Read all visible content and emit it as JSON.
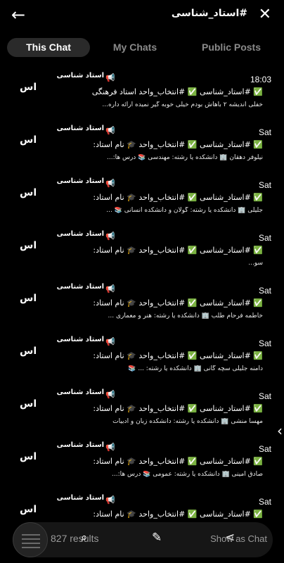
{
  "header": {
    "back_icon": "arrow-left-icon",
    "query": "#استاد_شناسی",
    "close_icon": "close-icon"
  },
  "tabs": [
    {
      "label": "This Chat",
      "active": true
    },
    {
      "label": "My Chats",
      "active": false
    },
    {
      "label": "Public Posts",
      "active": false
    }
  ],
  "results": [
    {
      "avatar": "اس",
      "author": "استاد شناسی",
      "time": "18:03",
      "line1": "✅ #استاد_شناسی ✅ #انتخاب_واحد استاد فرهنگی",
      "line2": "خفلی اندیشه ۲ باهاش بودم خیلی خوبه گیر نمیده ارائه داره..."
    },
    {
      "avatar": "اس",
      "author": "استاد شناسی",
      "time": "Sat",
      "line1": "✅ #استاد_شناسی ✅ #انتخاب_واحد 🎓 نام استاد:",
      "line2": "نیلوفر دهقان 🏢 دانشکده یا رشته: مهندسی 📚 درس ها:..."
    },
    {
      "avatar": "اس",
      "author": "استاد شناسی",
      "time": "Sat",
      "line1": "✅ #استاد_شناسی ✅ #انتخاب_واحد 🎓 نام استاد:",
      "line2": "جلیلی 🏢 دانشکده یا رشته: گولان و دانشکده انسانی 📚 ..."
    },
    {
      "avatar": "اس",
      "author": "استاد شناسی",
      "time": "Sat",
      "line1": "✅ #استاد_شناسی ✅ #انتخاب_واحد 🎓 نام استاد:",
      "line2": "سو..."
    },
    {
      "avatar": "اس",
      "author": "استاد شناسی",
      "time": "Sat",
      "line1": "✅ #استاد_شناسی ✅ #انتخاب_واحد 🎓 نام استاد:",
      "line2": "خاطمه فرحام طلب 🏢 دانشکده یا رشته: هنر و معماری ..."
    },
    {
      "avatar": "اس",
      "author": "استاد شناسی",
      "time": "Sat",
      "line1": "✅ #استاد_شناسی ✅ #انتخاب_واحد 🎓 نام استاد:",
      "line2": "دامنه جلیلی سچه گانی 🏢 دانشکده یا رشته: ... 📚"
    },
    {
      "avatar": "اس",
      "author": "استاد شناسی",
      "time": "Sat",
      "line1": "✅ #استاد_شناسی ✅ #انتخاب_واحد 🎓 نام استاد:",
      "line2": "مهسا منشی 🏢 دانشکده یا رشته: دانشکده زبان و ادبیات"
    },
    {
      "avatar": "اس",
      "author": "استاد شناسی",
      "time": "Sat",
      "line1": "✅ #استاد_شناسی ✅ #انتخاب_واحد 🎓 نام استاد:",
      "line2": "صادق امینی 🏢 دانشکده یا رشته: عمومی 📚 درس ها:..."
    },
    {
      "avatar": "اس",
      "author": "استاد شناسی",
      "time": "Sat",
      "line1": "✅ #استاد_شناسی ✅ #انتخاب_واحد 🎓 نام استاد:",
      "line2": ""
    }
  ],
  "bottom": {
    "count": "827 results",
    "show_label": "Show as Chat",
    "icons": [
      "calendar-search-icon",
      "edit-icon",
      "share-icon"
    ]
  }
}
